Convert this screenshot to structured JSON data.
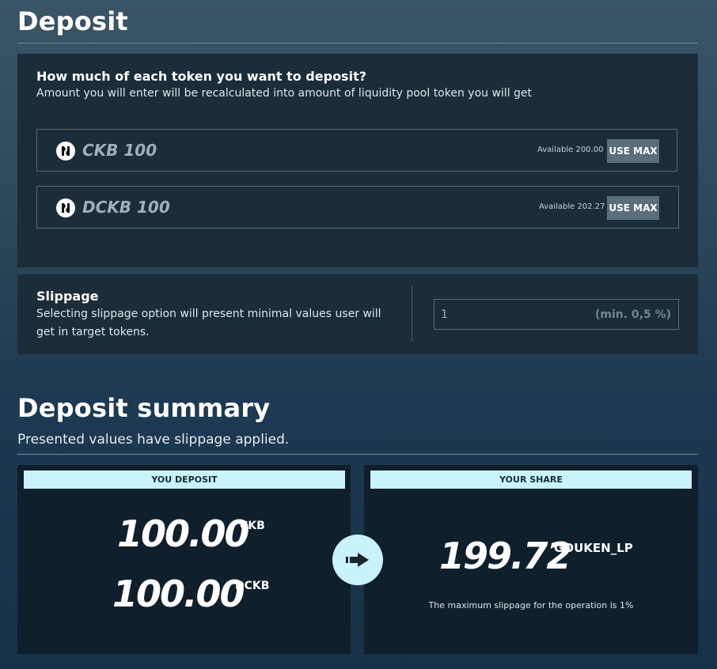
{
  "header": {
    "title": "Deposit"
  },
  "deposit": {
    "question": "How much of each token you want to deposit?",
    "description": "Amount you will enter will be recalculated into amount of liquidity pool token you will get",
    "tokens": [
      {
        "symbol": "CKB",
        "amount": "100",
        "available_label": "Available",
        "available_value": "200.00",
        "use_max_label": "USE MAX",
        "icon": "token-logo-icon"
      },
      {
        "symbol": "DCKB",
        "amount": "100",
        "available_label": "Available",
        "available_value": "202.27",
        "use_max_label": "USE MAX",
        "icon": "token-logo-icon"
      }
    ]
  },
  "slippage": {
    "title": "Slippage",
    "description_line1": "Selecting slippage option will present minimal values user will",
    "description_line2": "get in target tokens.",
    "value": "1",
    "hint": "(min. 0,5 %)"
  },
  "summary": {
    "title": "Deposit summary",
    "subtitle": "Presented values have slippage applied.",
    "you_deposit_label": "YOU DEPOSIT",
    "your_share_label": "YOUR SHARE",
    "deposits": [
      {
        "amount": "100.00",
        "unit": "CKB"
      },
      {
        "amount": "100.00",
        "unit": "DCKB"
      }
    ],
    "share": {
      "amount": "199.72",
      "unit": "GOUKEN_LP"
    },
    "note": "The maximum slippage for the operation is 1%"
  },
  "colors": {
    "accent_light": "#c9f3fb",
    "panel": "#1c2d3a",
    "dark_panel": "#0f1f2b",
    "button": "#5a6e7c"
  }
}
